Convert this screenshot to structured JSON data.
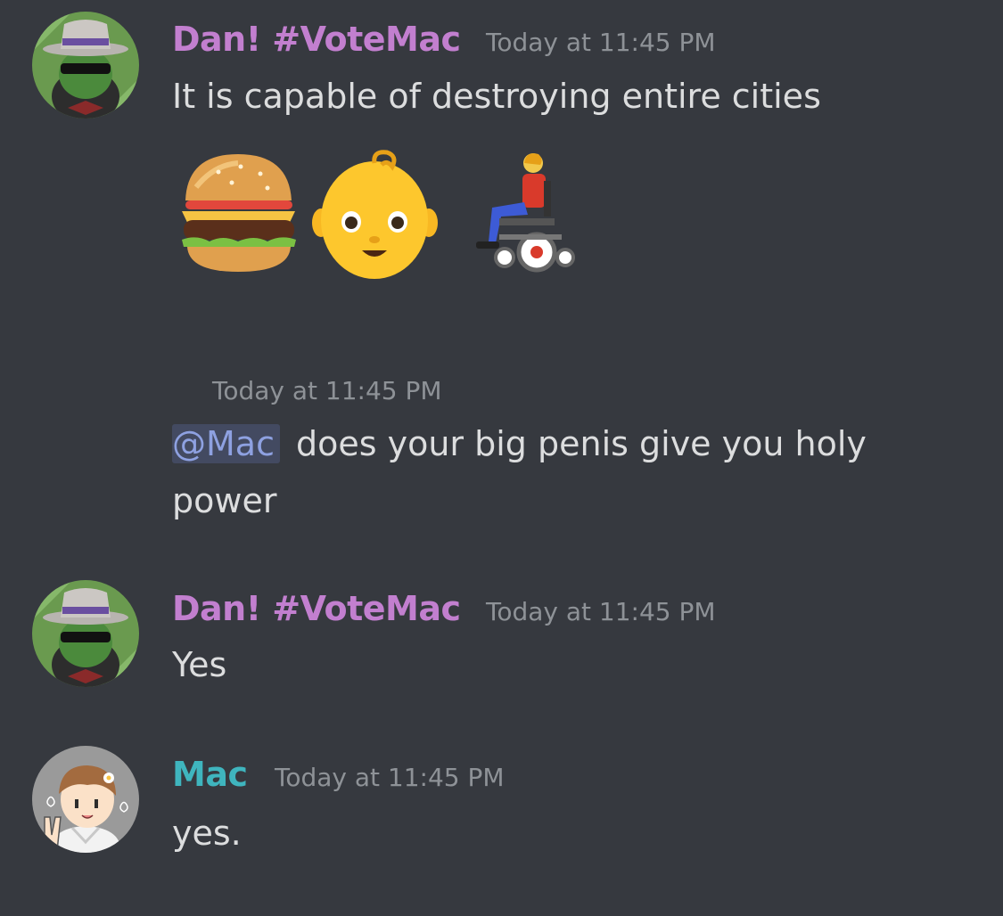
{
  "messages": [
    {
      "author": "Dan! #VoteMac",
      "author_color": "#c27fcf",
      "timestamp": "Today at 11:45 PM",
      "text": "It is capable of destroying entire cities",
      "emojis": [
        "hamburger-emoji",
        "baby-emoji",
        "person-in-motorized-wheelchair-emoji"
      ]
    },
    {
      "timestamp": "Today at 11:45 PM",
      "mention": "@Mac",
      "text_line1": "does your big penis give you holy",
      "text_line2": "power"
    },
    {
      "author": "Dan! #VoteMac",
      "author_color": "#c27fcf",
      "timestamp": "Today at 11:45 PM",
      "text": "Yes"
    },
    {
      "author": "Mac",
      "author_color": "#3fb5be",
      "timestamp": "Today at 11:45 PM",
      "text": "yes."
    }
  ],
  "colors": {
    "background": "#36393f",
    "message_text": "#dcddde",
    "timestamp": "#8e9297",
    "mention_text": "#8ea1e1"
  }
}
